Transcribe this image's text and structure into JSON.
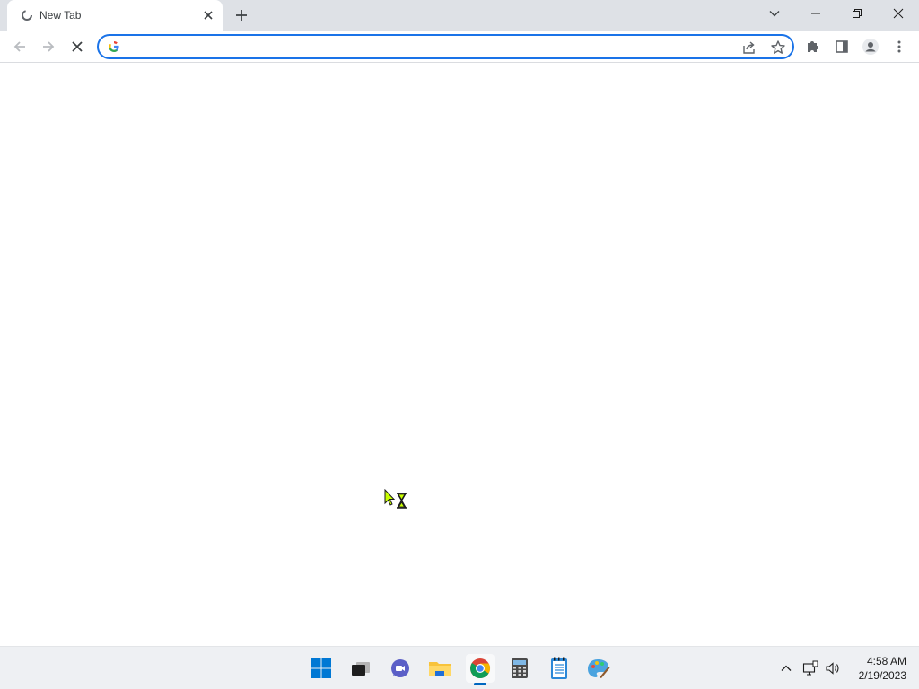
{
  "browser": {
    "tab": {
      "title": "New Tab"
    },
    "omnibox": {
      "value": "",
      "placeholder": ""
    }
  },
  "taskbar": {
    "apps": [
      {
        "name": "start",
        "icon": "windows-start-icon"
      },
      {
        "name": "task-view",
        "icon": "task-view-icon"
      },
      {
        "name": "chat",
        "icon": "chat-icon"
      },
      {
        "name": "file-explorer",
        "icon": "folder-icon"
      },
      {
        "name": "chrome",
        "icon": "chrome-icon",
        "active": true
      },
      {
        "name": "calculator",
        "icon": "calculator-icon"
      },
      {
        "name": "notepad",
        "icon": "notepad-icon"
      },
      {
        "name": "paint",
        "icon": "paint-icon"
      }
    ],
    "clock": {
      "time": "4:58 AM",
      "date": "2/19/2023"
    }
  },
  "colors": {
    "accent": "#1a73e8",
    "tabstrip": "#dee1e6",
    "taskbar": "#eef0f3",
    "taskbar_indicator": "#0067c0"
  }
}
